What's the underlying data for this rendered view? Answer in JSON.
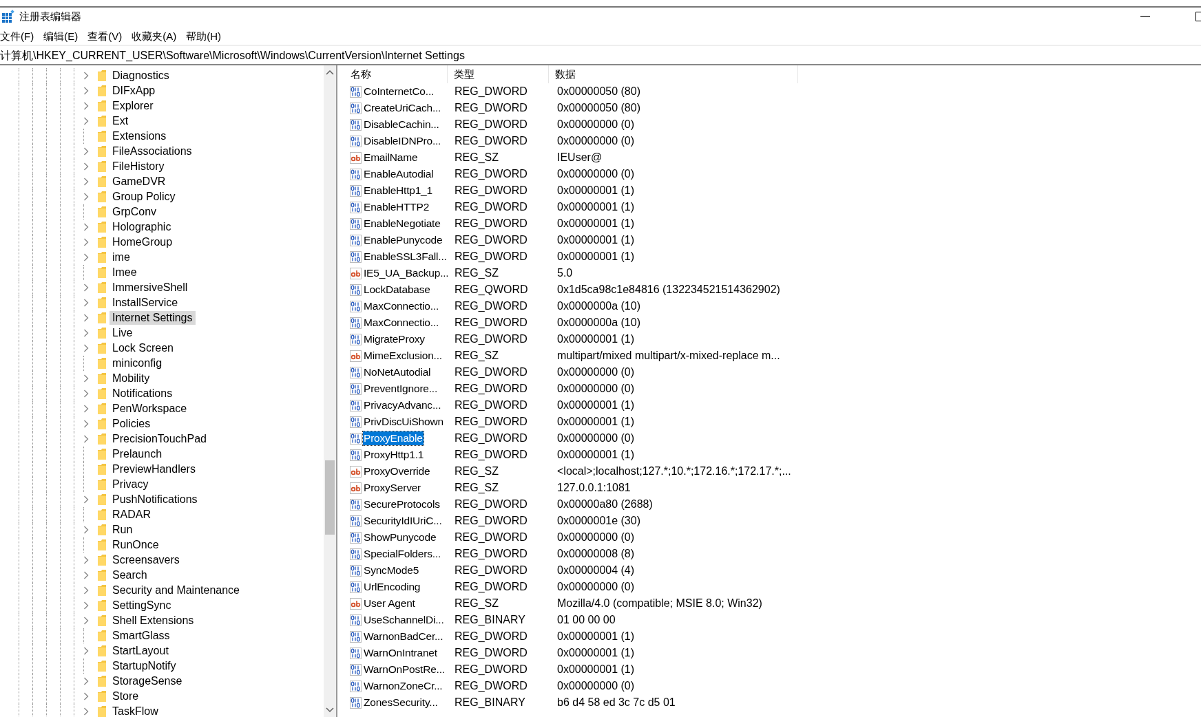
{
  "window": {
    "title": "注册表编辑器"
  },
  "menu": [
    "文件(F)",
    "编辑(E)",
    "查看(V)",
    "收藏夹(A)",
    "帮助(H)"
  ],
  "address": "计算机\\HKEY_CURRENT_USER\\Software\\Microsoft\\Windows\\CurrentVersion\\Internet Settings",
  "tree": [
    {
      "label": "Diagnostics",
      "has_children": true,
      "selected": false
    },
    {
      "label": "DIFxApp",
      "has_children": true,
      "selected": false
    },
    {
      "label": "Explorer",
      "has_children": true,
      "selected": false
    },
    {
      "label": "Ext",
      "has_children": true,
      "selected": false
    },
    {
      "label": "Extensions",
      "has_children": false,
      "selected": false
    },
    {
      "label": "FileAssociations",
      "has_children": true,
      "selected": false
    },
    {
      "label": "FileHistory",
      "has_children": true,
      "selected": false
    },
    {
      "label": "GameDVR",
      "has_children": true,
      "selected": false
    },
    {
      "label": "Group Policy",
      "has_children": true,
      "selected": false
    },
    {
      "label": "GrpConv",
      "has_children": false,
      "selected": false
    },
    {
      "label": "Holographic",
      "has_children": true,
      "selected": false
    },
    {
      "label": "HomeGroup",
      "has_children": true,
      "selected": false
    },
    {
      "label": "ime",
      "has_children": true,
      "selected": false
    },
    {
      "label": "Imee",
      "has_children": false,
      "selected": false
    },
    {
      "label": "ImmersiveShell",
      "has_children": true,
      "selected": false
    },
    {
      "label": "InstallService",
      "has_children": true,
      "selected": false
    },
    {
      "label": "Internet Settings",
      "has_children": true,
      "selected": true
    },
    {
      "label": "Live",
      "has_children": true,
      "selected": false
    },
    {
      "label": "Lock Screen",
      "has_children": true,
      "selected": false
    },
    {
      "label": "miniconfig",
      "has_children": false,
      "selected": false
    },
    {
      "label": "Mobility",
      "has_children": true,
      "selected": false
    },
    {
      "label": "Notifications",
      "has_children": true,
      "selected": false
    },
    {
      "label": "PenWorkspace",
      "has_children": true,
      "selected": false
    },
    {
      "label": "Policies",
      "has_children": true,
      "selected": false
    },
    {
      "label": "PrecisionTouchPad",
      "has_children": true,
      "selected": false
    },
    {
      "label": "Prelaunch",
      "has_children": false,
      "selected": false
    },
    {
      "label": "PreviewHandlers",
      "has_children": false,
      "selected": false
    },
    {
      "label": "Privacy",
      "has_children": false,
      "selected": false
    },
    {
      "label": "PushNotifications",
      "has_children": true,
      "selected": false
    },
    {
      "label": "RADAR",
      "has_children": false,
      "selected": false
    },
    {
      "label": "Run",
      "has_children": true,
      "selected": false
    },
    {
      "label": "RunOnce",
      "has_children": false,
      "selected": false
    },
    {
      "label": "Screensavers",
      "has_children": true,
      "selected": false
    },
    {
      "label": "Search",
      "has_children": true,
      "selected": false
    },
    {
      "label": "Security and Maintenance",
      "has_children": true,
      "selected": false
    },
    {
      "label": "SettingSync",
      "has_children": true,
      "selected": false
    },
    {
      "label": "Shell Extensions",
      "has_children": true,
      "selected": false
    },
    {
      "label": "SmartGlass",
      "has_children": false,
      "selected": false
    },
    {
      "label": "StartLayout",
      "has_children": true,
      "selected": false
    },
    {
      "label": "StartupNotify",
      "has_children": false,
      "selected": false
    },
    {
      "label": "StorageSense",
      "has_children": true,
      "selected": false
    },
    {
      "label": "Store",
      "has_children": true,
      "selected": false
    },
    {
      "label": "TaskFlow",
      "has_children": true,
      "selected": false
    }
  ],
  "table": {
    "columns": [
      "名称",
      "类型",
      "数据"
    ],
    "rows": [
      {
        "kind": "binary",
        "name": "CoInternetCo...",
        "type": "REG_DWORD",
        "data": "0x00000050 (80)",
        "selected": false
      },
      {
        "kind": "binary",
        "name": "CreateUriCach...",
        "type": "REG_DWORD",
        "data": "0x00000050 (80)",
        "selected": false
      },
      {
        "kind": "binary",
        "name": "DisableCachin...",
        "type": "REG_DWORD",
        "data": "0x00000000 (0)",
        "selected": false
      },
      {
        "kind": "binary",
        "name": "DisableIDNPro...",
        "type": "REG_DWORD",
        "data": "0x00000000 (0)",
        "selected": false
      },
      {
        "kind": "string",
        "name": "EmailName",
        "type": "REG_SZ",
        "data": "IEUser@",
        "selected": false
      },
      {
        "kind": "binary",
        "name": "EnableAutodial",
        "type": "REG_DWORD",
        "data": "0x00000000 (0)",
        "selected": false
      },
      {
        "kind": "binary",
        "name": "EnableHttp1_1",
        "type": "REG_DWORD",
        "data": "0x00000001 (1)",
        "selected": false
      },
      {
        "kind": "binary",
        "name": "EnableHTTP2",
        "type": "REG_DWORD",
        "data": "0x00000001 (1)",
        "selected": false
      },
      {
        "kind": "binary",
        "name": "EnableNegotiate",
        "type": "REG_DWORD",
        "data": "0x00000001 (1)",
        "selected": false
      },
      {
        "kind": "binary",
        "name": "EnablePunycode",
        "type": "REG_DWORD",
        "data": "0x00000001 (1)",
        "selected": false
      },
      {
        "kind": "binary",
        "name": "EnableSSL3Fall...",
        "type": "REG_DWORD",
        "data": "0x00000001 (1)",
        "selected": false
      },
      {
        "kind": "string",
        "name": "IE5_UA_Backup...",
        "type": "REG_SZ",
        "data": "5.0",
        "selected": false
      },
      {
        "kind": "binary",
        "name": "LockDatabase",
        "type": "REG_QWORD",
        "data": "0x1d5ca98c1e84816 (132234521514362902)",
        "selected": false
      },
      {
        "kind": "binary",
        "name": "MaxConnectio...",
        "type": "REG_DWORD",
        "data": "0x0000000a (10)",
        "selected": false
      },
      {
        "kind": "binary",
        "name": "MaxConnectio...",
        "type": "REG_DWORD",
        "data": "0x0000000a (10)",
        "selected": false
      },
      {
        "kind": "binary",
        "name": "MigrateProxy",
        "type": "REG_DWORD",
        "data": "0x00000001 (1)",
        "selected": false
      },
      {
        "kind": "string",
        "name": "MimeExclusion...",
        "type": "REG_SZ",
        "data": "multipart/mixed multipart/x-mixed-replace m...",
        "selected": false
      },
      {
        "kind": "binary",
        "name": "NoNetAutodial",
        "type": "REG_DWORD",
        "data": "0x00000000 (0)",
        "selected": false
      },
      {
        "kind": "binary",
        "name": "PreventIgnore...",
        "type": "REG_DWORD",
        "data": "0x00000000 (0)",
        "selected": false
      },
      {
        "kind": "binary",
        "name": "PrivacyAdvanc...",
        "type": "REG_DWORD",
        "data": "0x00000001 (1)",
        "selected": false
      },
      {
        "kind": "binary",
        "name": "PrivDiscUiShown",
        "type": "REG_DWORD",
        "data": "0x00000001 (1)",
        "selected": false
      },
      {
        "kind": "binary",
        "name": "ProxyEnable",
        "type": "REG_DWORD",
        "data": "0x00000000 (0)",
        "selected": true
      },
      {
        "kind": "binary",
        "name": "ProxyHttp1.1",
        "type": "REG_DWORD",
        "data": "0x00000001 (1)",
        "selected": false
      },
      {
        "kind": "string",
        "name": "ProxyOverride",
        "type": "REG_SZ",
        "data": "<local>;localhost;127.*;10.*;172.16.*;172.17.*;...",
        "selected": false
      },
      {
        "kind": "string",
        "name": "ProxyServer",
        "type": "REG_SZ",
        "data": "127.0.0.1:1081",
        "selected": false
      },
      {
        "kind": "binary",
        "name": "SecureProtocols",
        "type": "REG_DWORD",
        "data": "0x00000a80 (2688)",
        "selected": false
      },
      {
        "kind": "binary",
        "name": "SecurityIdIUriC...",
        "type": "REG_DWORD",
        "data": "0x0000001e (30)",
        "selected": false
      },
      {
        "kind": "binary",
        "name": "ShowPunycode",
        "type": "REG_DWORD",
        "data": "0x00000000 (0)",
        "selected": false
      },
      {
        "kind": "binary",
        "name": "SpecialFolders...",
        "type": "REG_DWORD",
        "data": "0x00000008 (8)",
        "selected": false
      },
      {
        "kind": "binary",
        "name": "SyncMode5",
        "type": "REG_DWORD",
        "data": "0x00000004 (4)",
        "selected": false
      },
      {
        "kind": "binary",
        "name": "UrlEncoding",
        "type": "REG_DWORD",
        "data": "0x00000000 (0)",
        "selected": false
      },
      {
        "kind": "string",
        "name": "User Agent",
        "type": "REG_SZ",
        "data": "Mozilla/4.0 (compatible; MSIE 8.0; Win32)",
        "selected": false
      },
      {
        "kind": "binary",
        "name": "UseSchannelDi...",
        "type": "REG_BINARY",
        "data": "01 00 00 00",
        "selected": false
      },
      {
        "kind": "binary",
        "name": "WarnonBadCer...",
        "type": "REG_DWORD",
        "data": "0x00000001 (1)",
        "selected": false
      },
      {
        "kind": "binary",
        "name": "WarnOnIntranet",
        "type": "REG_DWORD",
        "data": "0x00000001 (1)",
        "selected": false
      },
      {
        "kind": "binary",
        "name": "WarnOnPostRe...",
        "type": "REG_DWORD",
        "data": "0x00000001 (1)",
        "selected": false
      },
      {
        "kind": "binary",
        "name": "WarnonZoneCr...",
        "type": "REG_DWORD",
        "data": "0x00000000 (0)",
        "selected": false
      },
      {
        "kind": "binary",
        "name": "ZonesSecurity...",
        "type": "REG_BINARY",
        "data": "b6 d4 58 ed 3c 7c d5 01",
        "selected": false
      }
    ]
  }
}
